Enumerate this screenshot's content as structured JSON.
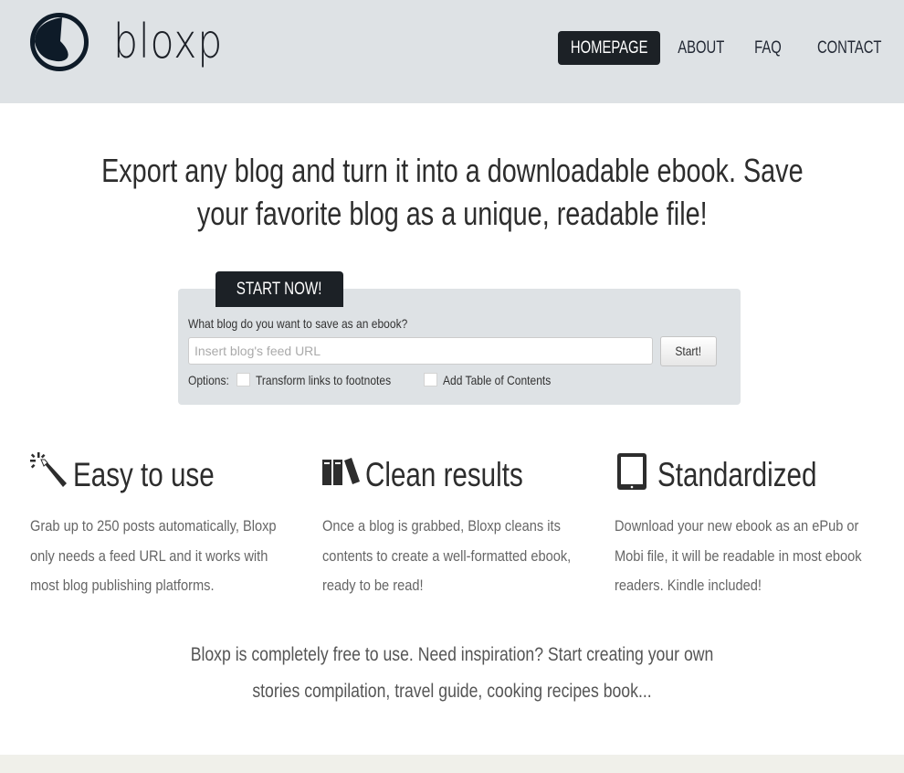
{
  "brand": {
    "name": "bloxp",
    "logo_icon": "bloxp-clock-logo",
    "color": "#0e1b28"
  },
  "nav": {
    "items": [
      {
        "label": "HOMEPAGE",
        "active": true
      },
      {
        "label": "ABOUT",
        "active": false
      },
      {
        "label": "FAQ",
        "active": false
      },
      {
        "label": "CONTACT",
        "active": false
      }
    ]
  },
  "hero": {
    "line1": "Export any blog and turn it into a downloadable ebook. Save",
    "line2": "your favorite blog as a unique, readable file!"
  },
  "form": {
    "tab_label": "START NOW!",
    "question": "What blog do you want to save as an ebook?",
    "url_placeholder": "Insert blog's feed URL",
    "url_value": "",
    "submit_label": "Start!",
    "options_label": "Options:",
    "options": [
      {
        "label": "Transform links to footnotes",
        "checked": false
      },
      {
        "label": "Add Table of Contents",
        "checked": false
      }
    ]
  },
  "features": [
    {
      "icon": "magic-wand-icon",
      "title": "Easy to use",
      "lines": [
        "Grab up to 250 posts automatically, Bloxp",
        "only needs a feed URL and it works with",
        "most blog publishing platforms."
      ]
    },
    {
      "icon": "books-icon",
      "title": "Clean results",
      "lines": [
        "Once a blog is grabbed, Bloxp cleans its",
        "contents to create a well-formatted ebook,",
        "ready to be read!"
      ]
    },
    {
      "icon": "tablet-icon",
      "title": "Standardized",
      "lines": [
        "Download your new ebook as an ePub or",
        "Mobi file, it will be readable in most ebook",
        "readers. Kindle included!"
      ]
    }
  ],
  "tagline": {
    "line1": "Bloxp is completely free to use. Need inspiration? Start creating your own",
    "line2": "stories compilation, travel guide, cooking recipes book..."
  },
  "colors": {
    "header_bg": "#dee2e5",
    "dark": "#1c2126",
    "footer_bg": "#f0f0ea"
  }
}
